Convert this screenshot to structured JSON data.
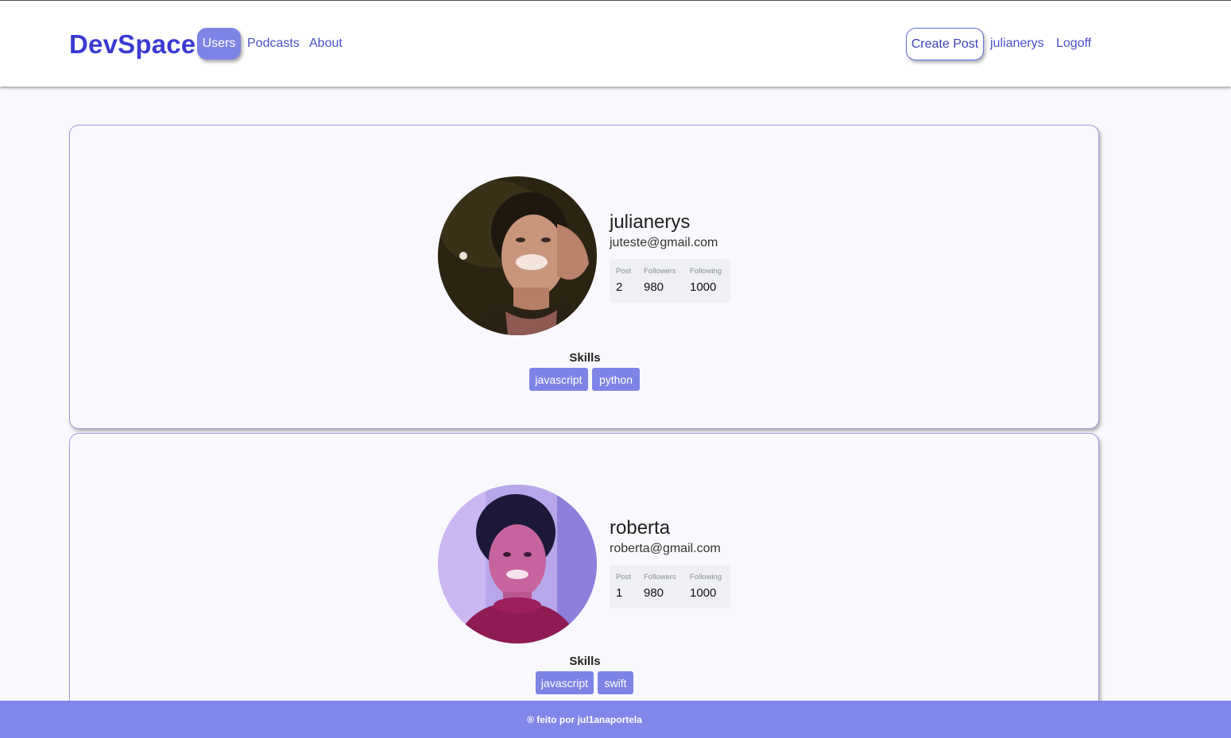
{
  "header": {
    "brand": "DevSpace",
    "nav": {
      "users": "Users",
      "podcasts": "Podcasts",
      "about": "About"
    },
    "actions": {
      "create_post": "Create Post",
      "username": "julianerys",
      "logoff": "Logoff"
    }
  },
  "stat_labels": {
    "post": "Post",
    "followers": "Followers",
    "following": "Following"
  },
  "users": [
    {
      "username": "julianerys",
      "email": "juteste@gmail.com",
      "post": "2",
      "followers": "980",
      "following": "1000",
      "skills_title": "Skills",
      "skills": [
        "javascript",
        "python"
      ]
    },
    {
      "username": "roberta",
      "email": "roberta@gmail.com",
      "post": "1",
      "followers": "980",
      "following": "1000",
      "skills_title": "Skills",
      "skills": [
        "javascript",
        "swift"
      ]
    }
  ],
  "footer": {
    "text": "® feito por jul1anaportela"
  },
  "colors": {
    "brand": "#3b3bd1",
    "accent": "#7e84e6",
    "footer": "#8086ea",
    "background": "#f9f9fd"
  }
}
